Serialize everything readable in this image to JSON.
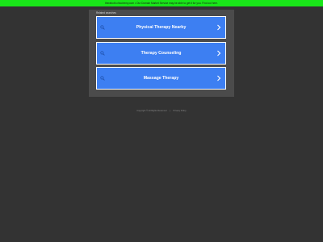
{
  "banner": {
    "text": "theraboth.chicchemy.com • Our Domain Market Service may be able to get it for you. Find out here.",
    "color": "#19e619"
  },
  "panel": {
    "heading": "Related searches",
    "background": "#4b4b4b"
  },
  "links": [
    {
      "label": "Physical Therapy Nearby",
      "icon": "search-icon",
      "arrow": "chevron-right-icon"
    },
    {
      "label": "Therapy Counseling",
      "icon": "search-icon",
      "arrow": "chevron-right-icon"
    },
    {
      "label": "Massage Therapy",
      "icon": "search-icon",
      "arrow": "chevron-right-icon"
    }
  ],
  "footer": {
    "copyright": "Copyright © All Rights Reserved",
    "privacy": "Privacy Policy"
  },
  "colors": {
    "page_background": "#333333",
    "link_background": "#3d7ff2",
    "link_border": "#ffffff"
  }
}
